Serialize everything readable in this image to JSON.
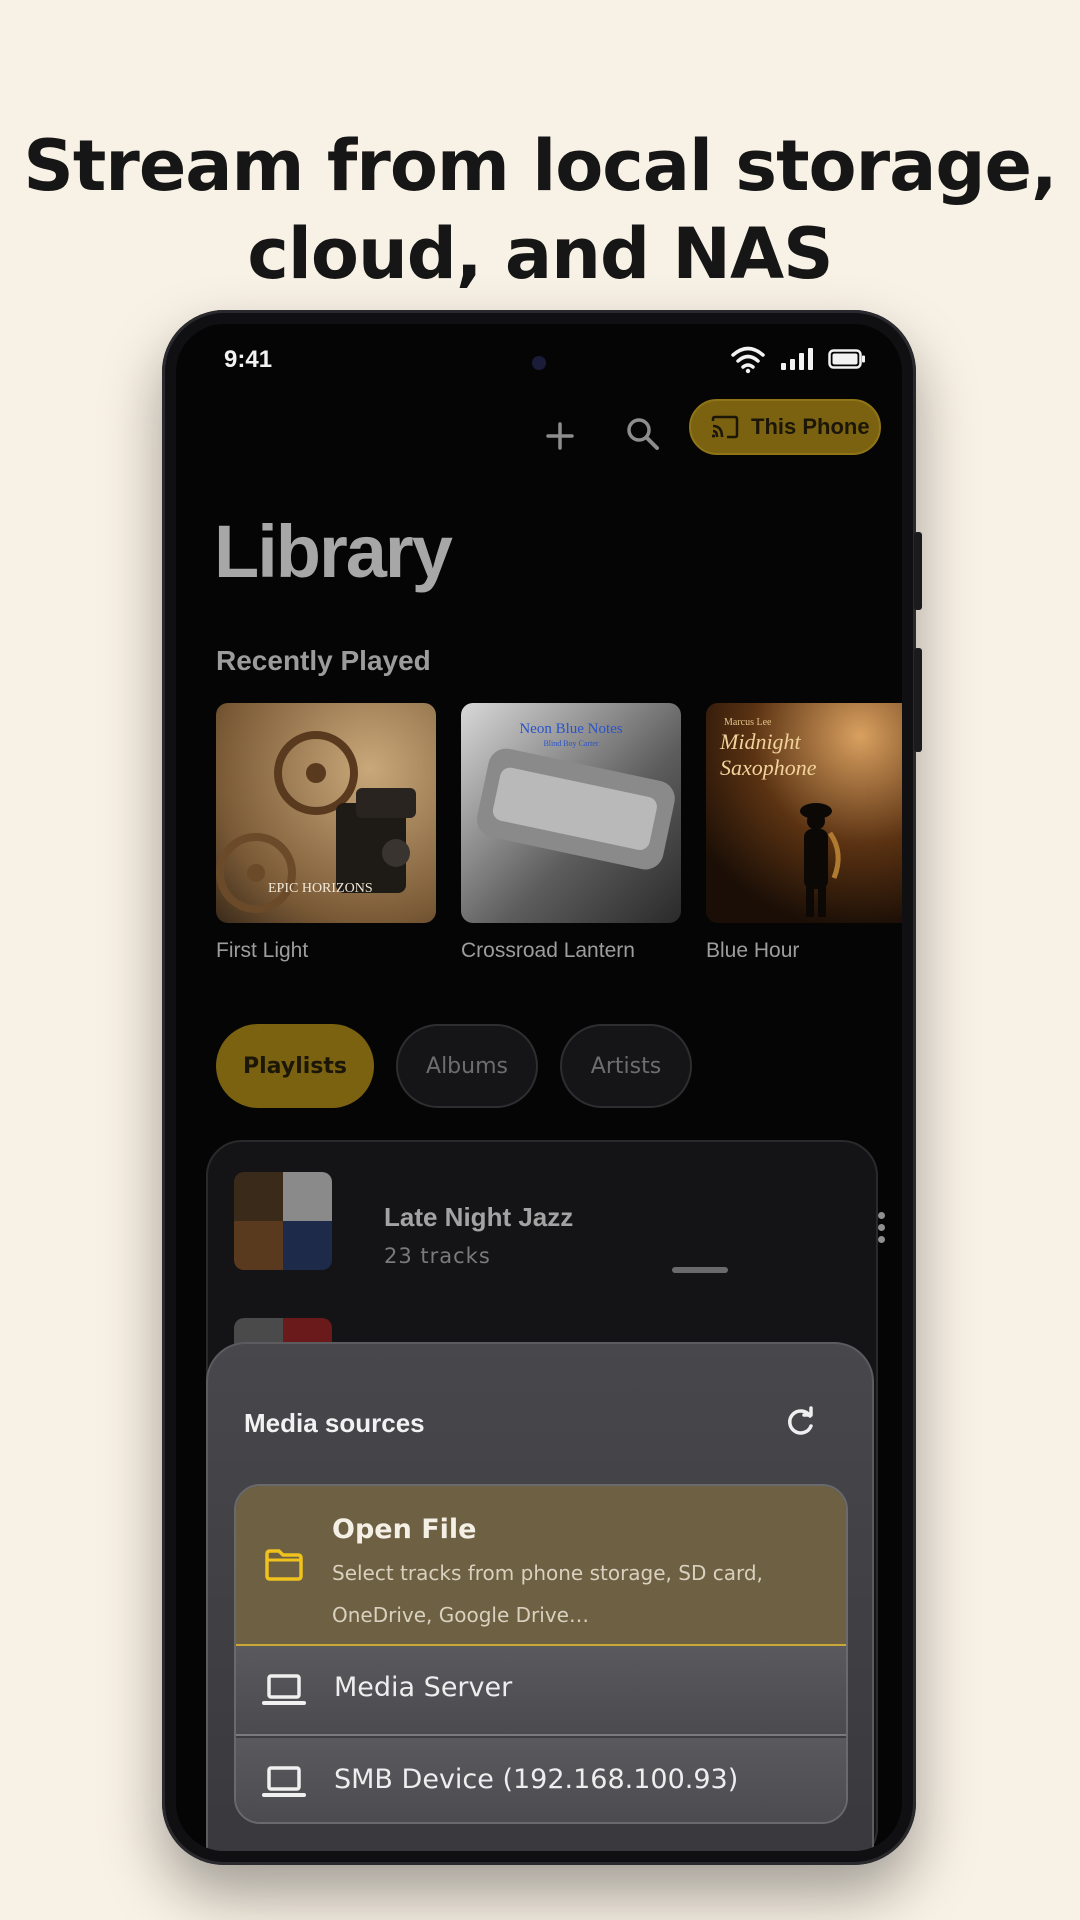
{
  "headline": {
    "line1": "Stream from local storage,",
    "line2": "cloud, and NAS"
  },
  "status_bar": {
    "time": "9:41",
    "icons": [
      "wifi-icon",
      "signal-icon",
      "battery-icon"
    ]
  },
  "top_bar": {
    "add_icon": "plus-icon",
    "search_icon": "search-icon",
    "output_chip": {
      "icon": "cast-icon",
      "label": "This Phone"
    }
  },
  "library": {
    "title": "Library",
    "recently_played_title": "Recently Played",
    "albums": [
      {
        "name": "First Light",
        "cover_text": "EPIC HORIZONS"
      },
      {
        "name": "Crossroad Lantern",
        "cover_title": "Neon Blue Notes",
        "cover_artist": "Blind Boy Carter"
      },
      {
        "name": "Blue Hour",
        "cover_artist": "Marcus Lee",
        "cover_title_1": "Midnight",
        "cover_title_2": "Saxophone"
      }
    ],
    "tabs": [
      {
        "label": "Playlists",
        "active": true
      },
      {
        "label": "Albums",
        "active": false
      },
      {
        "label": "Artists",
        "active": false
      }
    ],
    "playlists": [
      {
        "title": "Late Night Jazz",
        "subtitle": "23 tracks"
      }
    ]
  },
  "media_sources": {
    "title": "Media sources",
    "refresh_icon": "refresh-icon",
    "items": [
      {
        "icon": "folder-icon",
        "title": "Open File",
        "description": "Select tracks from phone storage, SD card, OneDrive, Google Drive…"
      },
      {
        "icon": "laptop-icon",
        "title": "Media Server"
      },
      {
        "icon": "laptop-icon",
        "title": "SMB Device (192.168.100.93)"
      }
    ]
  },
  "colors": {
    "accent": "#7a6210",
    "page_background": "#f8f1e5",
    "sheet_background": "#47474c"
  }
}
